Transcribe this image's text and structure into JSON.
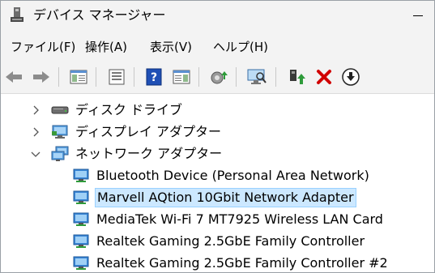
{
  "window": {
    "title": "デバイス マネージャー"
  },
  "menu": [
    {
      "label": "ファイル(F)"
    },
    {
      "label": "操作(A)"
    },
    {
      "label": "表示(V)"
    },
    {
      "label": "ヘルプ(H)"
    }
  ],
  "toolbar": [
    {
      "icon": "back-arrow-icon"
    },
    {
      "icon": "forward-arrow-icon"
    },
    {
      "icon": "console-tree-icon"
    },
    {
      "icon": "properties-icon"
    },
    {
      "icon": "help-icon"
    },
    {
      "icon": "action-pane-icon"
    },
    {
      "icon": "update-driver-icon"
    },
    {
      "icon": "scan-hardware-icon"
    },
    {
      "icon": "enable-device-icon"
    },
    {
      "icon": "uninstall-device-icon"
    },
    {
      "icon": "download-driver-icon"
    }
  ],
  "tree": {
    "categories": [
      {
        "label": "ディスク ドライブ",
        "expanded": false,
        "icon": "disk-drive-icon"
      },
      {
        "label": "ディスプレイ アダプター",
        "expanded": false,
        "icon": "display-adapter-icon"
      },
      {
        "label": "ネットワーク アダプター",
        "expanded": true,
        "icon": "network-adapter-icon"
      }
    ],
    "devices": [
      {
        "label": "Bluetooth Device (Personal Area Network)",
        "selected": false
      },
      {
        "label": "Marvell AQtion 10Gbit Network Adapter",
        "selected": true
      },
      {
        "label": "MediaTek Wi-Fi 7 MT7925 Wireless LAN Card",
        "selected": false
      },
      {
        "label": "Realtek Gaming 2.5GbE Family Controller",
        "selected": false
      },
      {
        "label": "Realtek Gaming 2.5GbE Family Controller #2",
        "selected": false
      }
    ]
  },
  "colors": {
    "selection_bg": "#cce8ff",
    "selection_border": "#99d1ff",
    "uninstall_red": "#d10000",
    "help_blue": "#1f4fb5"
  }
}
